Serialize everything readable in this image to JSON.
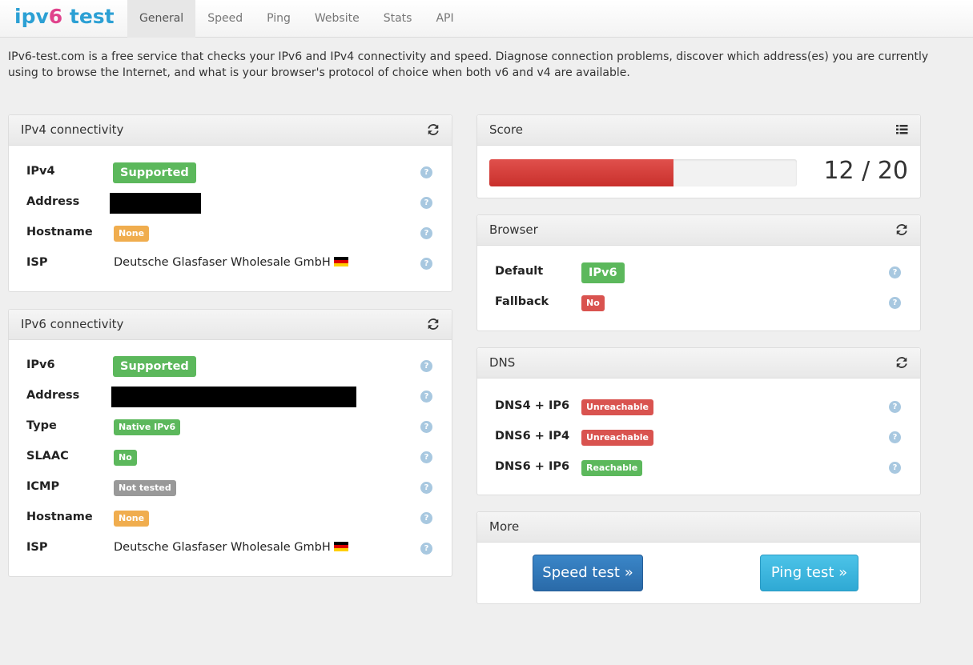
{
  "logo": {
    "part1": "ipv",
    "part2": "6",
    "part3": " test"
  },
  "nav": [
    "General",
    "Speed",
    "Ping",
    "Website",
    "Stats",
    "API"
  ],
  "intro": "IPv6-test.com is a free service that checks your IPv6 and IPv4 connectivity and speed. Diagnose connection problems, discover which address(es) you are currently using to browse the Internet, and what is your browser's protocol of choice when both v6 and v4 are available.",
  "ipv4": {
    "title": "IPv4 connectivity",
    "rows": {
      "ipv4": {
        "label": "IPv4",
        "value": "Supported"
      },
      "address": {
        "label": "Address"
      },
      "hostname": {
        "label": "Hostname",
        "value": "None"
      },
      "isp": {
        "label": "ISP",
        "value": "Deutsche Glasfaser Wholesale GmbH"
      }
    }
  },
  "ipv6": {
    "title": "IPv6 connectivity",
    "rows": {
      "ipv6": {
        "label": "IPv6",
        "value": "Supported"
      },
      "address": {
        "label": "Address"
      },
      "type": {
        "label": "Type",
        "value": "Native IPv6"
      },
      "slaac": {
        "label": "SLAAC",
        "value": "No"
      },
      "icmp": {
        "label": "ICMP",
        "value": "Not tested"
      },
      "hostname": {
        "label": "Hostname",
        "value": "None"
      },
      "isp": {
        "label": "ISP",
        "value": "Deutsche Glasfaser Wholesale GmbH"
      }
    }
  },
  "score": {
    "title": "Score",
    "text": "12 / 20",
    "fraction": 0.6
  },
  "browser": {
    "title": "Browser",
    "default": {
      "label": "Default",
      "value": "IPv6"
    },
    "fallback": {
      "label": "Fallback",
      "value": "No"
    }
  },
  "dns": {
    "title": "DNS",
    "dns4ip6": {
      "label": "DNS4 + IP6",
      "value": "Unreachable"
    },
    "dns6ip4": {
      "label": "DNS6 + IP4",
      "value": "Unreachable"
    },
    "dns6ip6": {
      "label": "DNS6 + IP6",
      "value": "Reachable"
    }
  },
  "more": {
    "title": "More",
    "speed_btn": "Speed test »",
    "ping_btn": "Ping test »"
  },
  "help_glyph": "?",
  "colors": {
    "success": "#5cb85c",
    "warning": "#f0ad4e",
    "danger": "#d9534f",
    "muted": "#999999",
    "primary": "#337ab7",
    "info": "#5bc0de"
  },
  "icons": {
    "refresh": "refresh-icon",
    "list": "list-icon",
    "help": "help-icon",
    "flag": "flag-de-icon"
  }
}
